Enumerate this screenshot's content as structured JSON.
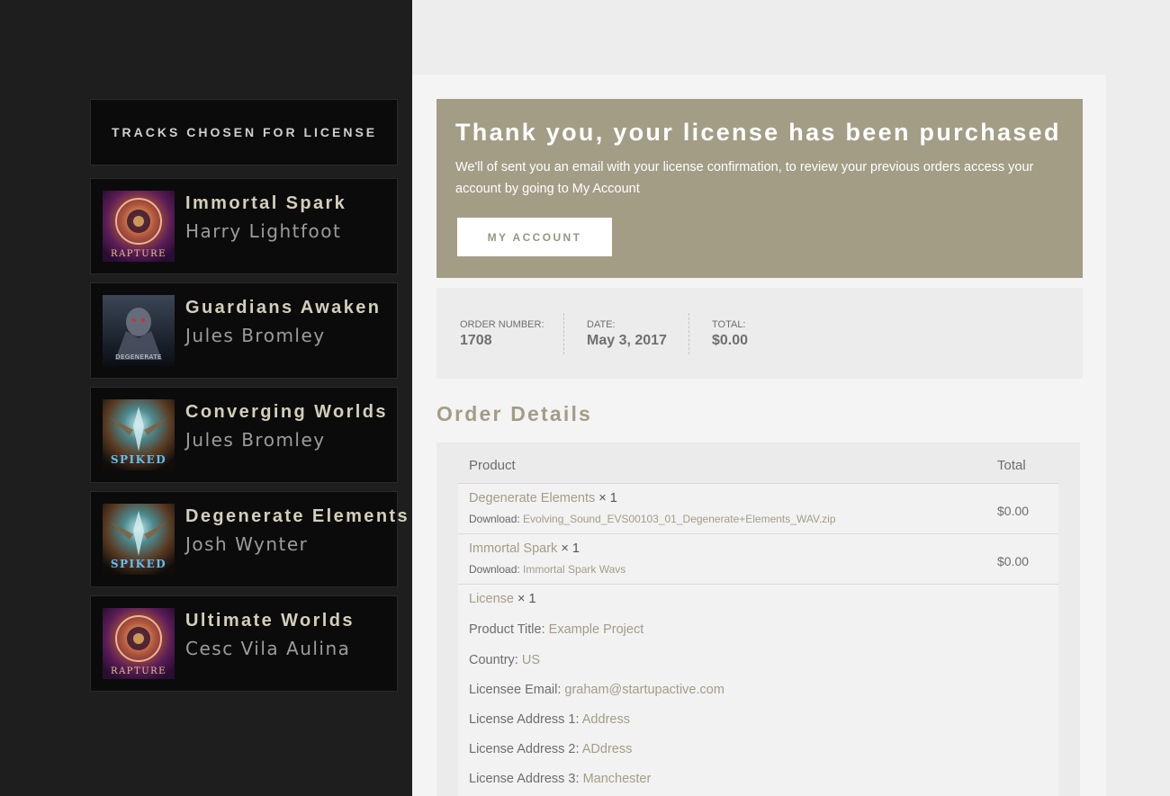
{
  "sidebar": {
    "header": "TRACKS CHOSEN FOR LICENSE",
    "tracks": [
      {
        "title": "Immortal Spark",
        "artist": "Harry Lightfoot",
        "art_text": "RAPTURE",
        "art_icon": "rapture-album-art-icon"
      },
      {
        "title": "Guardians Awaken",
        "artist": "Jules Bromley",
        "art_text": "DEGENERATE",
        "art_icon": "degenerate-album-art-icon"
      },
      {
        "title": "Converging Worlds",
        "artist": "Jules Bromley",
        "art_text": "SPIKED",
        "art_icon": "spiked-album-art-icon"
      },
      {
        "title": "Degenerate Elements",
        "artist": "Josh Wynter",
        "art_text": "SPIKED",
        "art_icon": "spiked-album-art-icon"
      },
      {
        "title": "Ultimate Worlds",
        "artist": "Cesc Vila Aulina",
        "art_text": "RAPTURE",
        "art_icon": "rapture-album-art-icon"
      }
    ]
  },
  "banner": {
    "title": "Thank you, your license has been purchased",
    "message": "We'll of sent you an email with your license confirmation, to review your previous orders access your account by going to My Account",
    "button": "MY ACCOUNT",
    "color": "#a39d86"
  },
  "order": {
    "number_label": "ORDER NUMBER:",
    "number": "1708",
    "date_label": "DATE:",
    "date": "May 3, 2017",
    "total_label": "TOTAL:",
    "total": "$0.00"
  },
  "order_details": {
    "heading": "Order Details",
    "col_product": "Product",
    "col_total": "Total",
    "items": [
      {
        "name": "Degenerate Elements",
        "qty": "× 1",
        "download_label": "Download:",
        "download_file": "Evolving_Sound_EVS00103_01_Degenerate+Elements_WAV.zip",
        "price": "$0.00"
      },
      {
        "name": "Immortal Spark",
        "qty": "× 1",
        "download_label": "Download:",
        "download_file": "Immortal Spark Wavs",
        "price": "$0.00"
      }
    ],
    "license": {
      "name": "License",
      "qty": "× 1",
      "fields": [
        {
          "label": "Product Title:",
          "value": "Example Project"
        },
        {
          "label": "Country:",
          "value": "US"
        },
        {
          "label": "Licensee Email:",
          "value": "graham@startupactive.com"
        },
        {
          "label": "License Address 1:",
          "value": "Address"
        },
        {
          "label": "License Address 2:",
          "value": "ADdress"
        },
        {
          "label": "License Address 3:",
          "value": "Manchester"
        }
      ]
    }
  }
}
